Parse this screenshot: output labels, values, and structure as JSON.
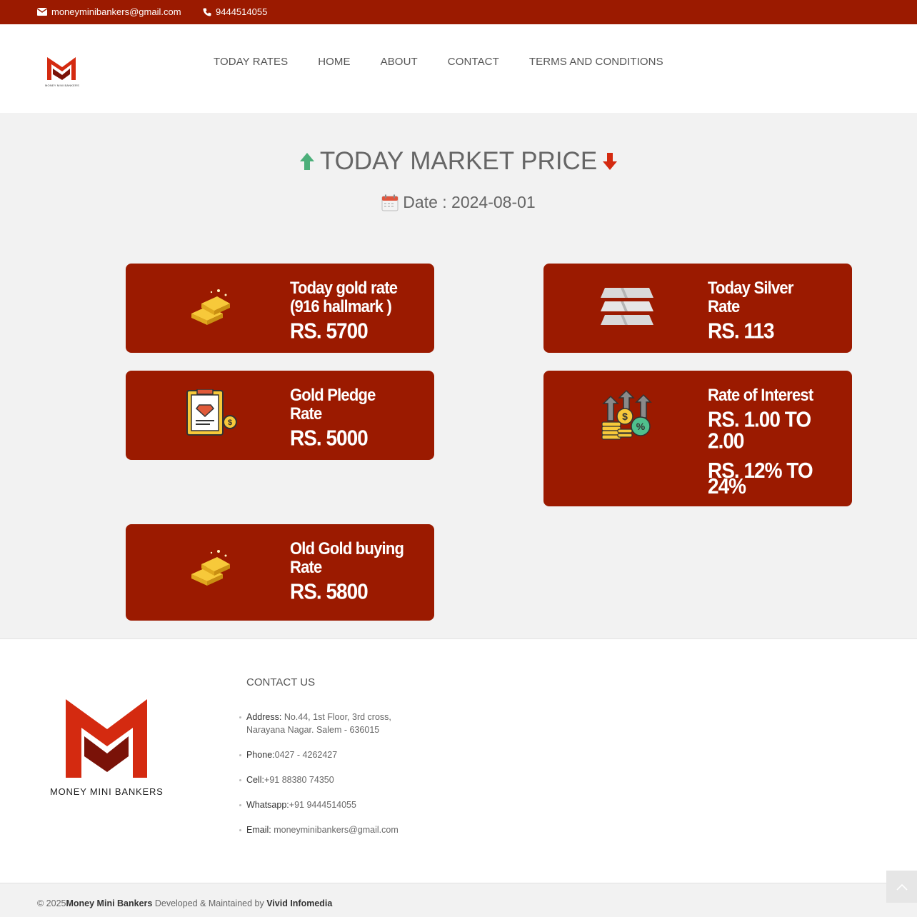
{
  "topbar": {
    "email": "moneyminibankers@gmail.com",
    "phone": "9444514055"
  },
  "header": {
    "logo_tiny_text": "MONEY MINI BANKERS",
    "nav": [
      "TODAY RATES",
      "HOME",
      "ABOUT",
      "CONTACT",
      "TERMS AND CONDITIONS"
    ]
  },
  "main": {
    "title": "TODAY MARKET PRICE",
    "date_label": "Date : 2024-08-01"
  },
  "cards": [
    {
      "label_1": "Today gold rate",
      "label_2": "(916 hallmark )",
      "value": "RS. 5700",
      "icon": "gold-bar-icon"
    },
    {
      "label_1": "Today Silver",
      "label_2": "Rate",
      "value": "RS. 113",
      "icon": "silver-bars-icon"
    },
    {
      "label_1": "Gold Pledge",
      "label_2": "Rate",
      "value": "RS. 5000",
      "icon": "pledge-document-icon"
    },
    {
      "label_1": "Rate of Interest",
      "value_1": "RS. 1.00 TO",
      "value_2": "2.00",
      "value_3": "RS. 12% TO",
      "value_4": "24%",
      "icon": "interest-coins-icon"
    },
    {
      "label_1": "Old Gold buying",
      "label_2": "Rate",
      "value": "RS. 5800",
      "icon": "gold-bar-icon"
    }
  ],
  "footer": {
    "brand": "MONEY MINI BANKERS",
    "contact_title": "CONTACT US",
    "address_key": "Address:",
    "address_line_1": " No.44, 1st Floor, 3rd cross,",
    "address_line_2": "Narayana Nagar. Salem - 636015",
    "phone_key": "Phone:",
    "phone_val": "0427 - 4262427",
    "cell_key": "Cell:",
    "cell_val": "+91 88380 74350",
    "whatsapp_key": "Whatsapp:",
    "whatsapp_val": "+91 9444514055",
    "email_key": "Email:",
    "email_val": " moneyminibankers@gmail.com"
  },
  "bottombar": {
    "copy_prefix": "© 2025",
    "company": "Money Mini Bankers",
    "middle": " Developed & Maintained by ",
    "developer": "Vivid Infomedia"
  },
  "colors": {
    "brand_red": "#9b1a00",
    "logo_red": "#d42a10",
    "up_arrow": "#4caf7a",
    "down_arrow": "#d42a10"
  }
}
